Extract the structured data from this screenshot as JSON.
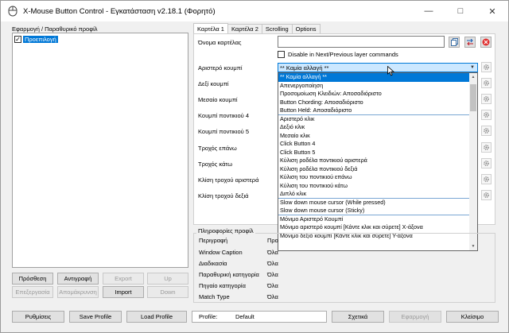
{
  "window": {
    "title": "X-Mouse Button Control - Εγκατάσταση v2.18.1 (Φορητό)"
  },
  "left_panel": {
    "title": "Εφαρμογή / Παραθυρικό προφίλ",
    "profiles": [
      {
        "label": "Προεπιλογή",
        "checked": true
      }
    ],
    "buttons": [
      {
        "label": "Πρόσθεση",
        "enabled": true
      },
      {
        "label": "Αντιγραφή",
        "enabled": true
      },
      {
        "label": "Export",
        "enabled": false
      },
      {
        "label": "Up",
        "enabled": false
      },
      {
        "label": "Επεξεργασία",
        "enabled": false
      },
      {
        "label": "Απομάκρυνση",
        "enabled": false
      },
      {
        "label": "Import",
        "enabled": true
      },
      {
        "label": "Down",
        "enabled": false
      }
    ]
  },
  "tabs": [
    "Καρτέλα 1",
    "Καρτέλα 2",
    "Scrolling",
    "Options"
  ],
  "active_tab": "Καρτέλα 1",
  "fields": {
    "tab_name_label": "Όνομα καρτέλας",
    "tab_name_value": "",
    "disable_layer_label": "Disable in Next/Previous layer commands"
  },
  "button_rows": [
    "Αριστερό κουμπί",
    "Δεξί κουμπί",
    "Μεσαίο κουμπί",
    "Κουμπί ποντικιού 4",
    "Κουμπί ποντικιού 5",
    "Τροχός επάνω",
    "Τροχός κάτω",
    "Κλίση τροχού αριστερά",
    "Κλίση τροχού δεξιά"
  ],
  "combo": {
    "value": "** Καμία αλλαγή **"
  },
  "dropdown_options": [
    "** Καμία αλλαγή **",
    "Απενεργοποίηση",
    "Προσομοίωση Κλειδιών: Αποσαδιόριστο",
    "Button Chording: Αποσαδιόριστο",
    "Button Held: Αποσαδιόριστο",
    "Αριστερό κλικ",
    "Δεξιό κλικ",
    "Μεσαίο κλικ",
    "Click Button 4",
    "Click Button 5",
    "Κύλιση ροδέλα ποντικιού αριστερά",
    "Κύλιση ροδέλα ποντικιού δεξιά",
    "Κύλιση του ποντικιού επάνω",
    "Κύλιση του ποντικιού κάτω",
    "Διπλό κλικ",
    "Slow down mouse cursor (While pressed)",
    "Slow down mouse cursor (Sticky)",
    "Μόνιμο Αριστερό Κουμπί",
    "Μόνιμο αριστερό κουμπί [Κάντε κλικ και σύρετε] X-άξονα",
    "Μόνιμο δεξιό κουμπί [Κάντε κλικ και σύρετε] Y-άξονα"
  ],
  "profile_info": {
    "title": "Πληροφορίες προφίλ",
    "rows": [
      {
        "label": "Περιγραφή",
        "value": "Προ"
      },
      {
        "label": "Window Caption",
        "value": "Όλα"
      },
      {
        "label": "Διαδικασία",
        "value": "Όλα"
      },
      {
        "label": "Παραθυρική κατηγορία",
        "value": "Όλα"
      },
      {
        "label": "Πηγαίο κατηγορία",
        "value": "Όλα"
      },
      {
        "label": "Match Type",
        "value": "Όλα"
      }
    ]
  },
  "bottom": {
    "settings": "Ρυθμίσεις",
    "save_profile": "Save Profile",
    "load_profile": "Load Profile",
    "profile_label": "Profile:",
    "profile_value": "Default",
    "about": "Σχετικά",
    "apply": "Εφαρμογή",
    "close": "Κλείσιμο"
  },
  "colors": {
    "accent": "#0078d7",
    "combo_bg": "#cce8ff",
    "window_bg": "#f0f0f0"
  }
}
